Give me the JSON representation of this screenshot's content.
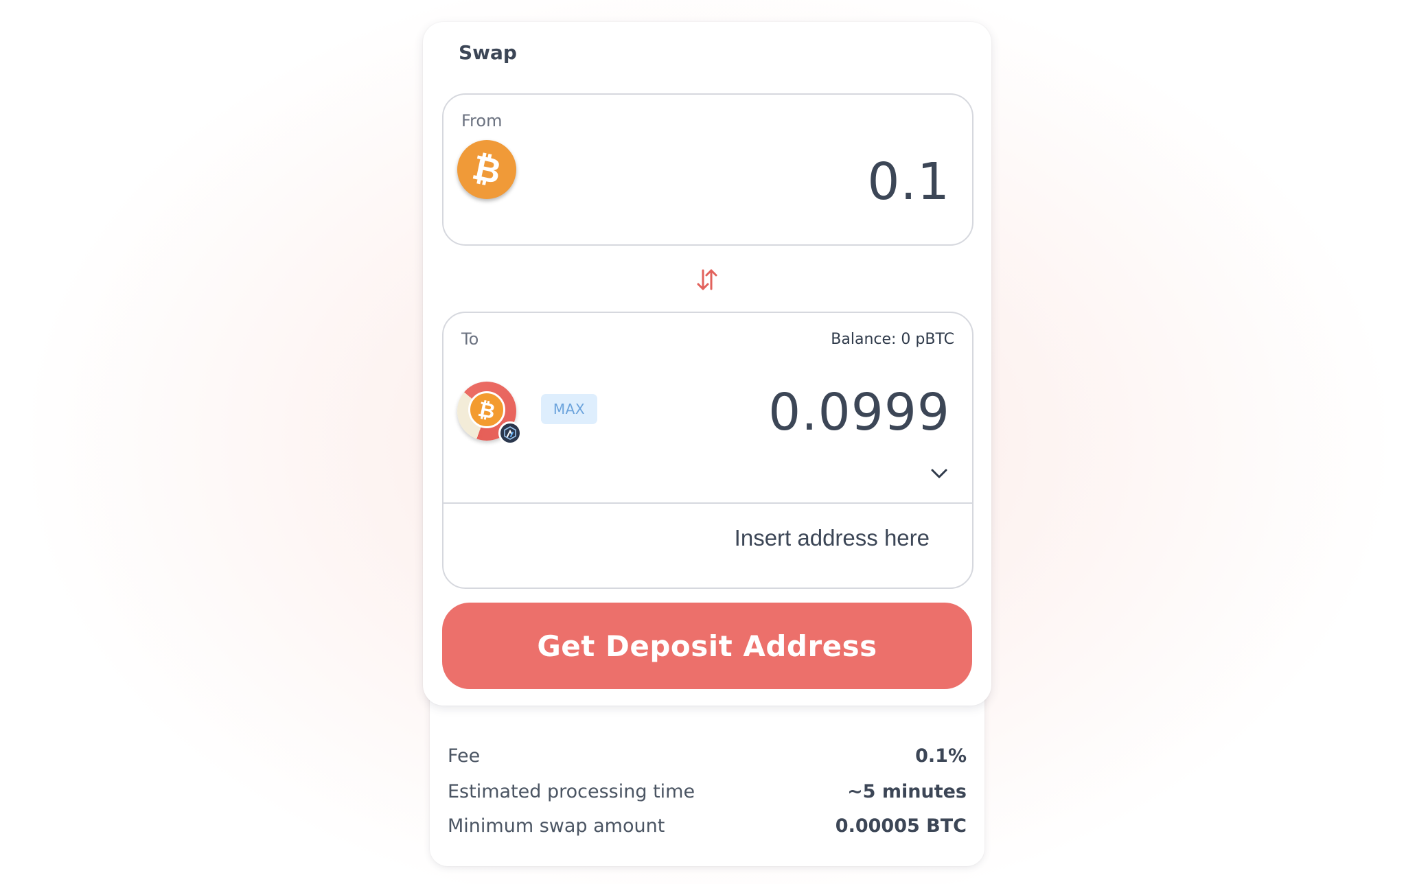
{
  "swap": {
    "title": "Swap",
    "from": {
      "label": "From",
      "coin_icon": "bitcoin-icon",
      "amount": "0.1"
    },
    "switch_icon": "swap-arrows-icon",
    "to": {
      "label": "To",
      "balance": "Balance: 0 pBTC",
      "coin_icon": "pbtc-icon",
      "network_icon": "arbitrum-icon",
      "max_label": "MAX",
      "amount": "0.0999",
      "dropdown_icon": "chevron-down-icon",
      "address_placeholder": "Insert address here"
    },
    "cta_label": "Get Deposit Address"
  },
  "info": {
    "rows": [
      {
        "label": "Fee",
        "value": "0.1%"
      },
      {
        "label": "Estimated processing time",
        "value": "~5 minutes"
      },
      {
        "label": "Minimum swap amount",
        "value": "0.00005 BTC"
      }
    ]
  },
  "colors": {
    "accent": "#ec706b",
    "bitcoin": "#f09a38",
    "max_bg": "#deeefd",
    "max_text": "#6ba3dc",
    "text": "#3c4656"
  }
}
